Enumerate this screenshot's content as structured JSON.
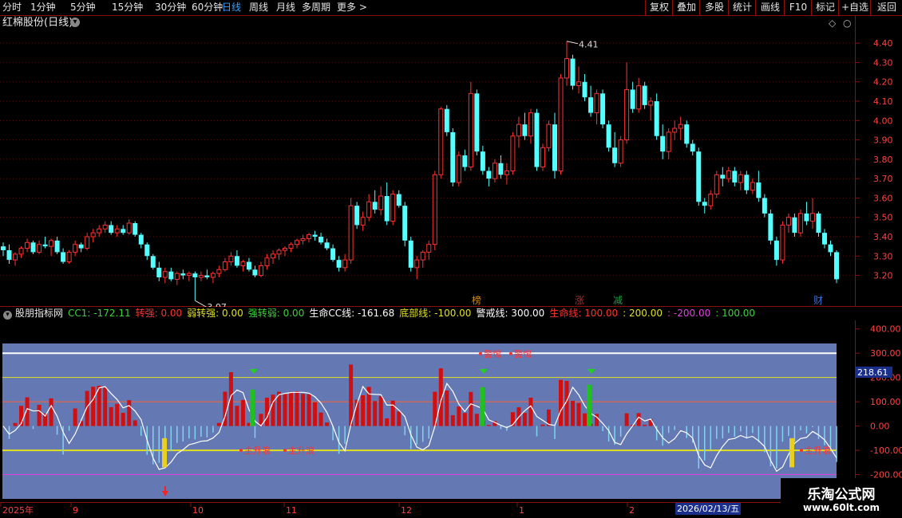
{
  "toolbar": {
    "periods": [
      "分时",
      "1分钟",
      "5分钟",
      "15分钟",
      "30分钟",
      "60分钟",
      "日线",
      "周线",
      "月线",
      "多周期",
      "更多 >"
    ],
    "active": "日线",
    "right_buttons": [
      "复权",
      "叠加",
      "多股",
      "统计",
      "画线",
      "F10",
      "标记",
      "+自选",
      "返回"
    ]
  },
  "stock": {
    "name": "红棉股份(日线)"
  },
  "price_axis": {
    "labels": [
      "4.40",
      "4.30",
      "4.20",
      "4.10",
      "4.00",
      "3.90",
      "3.80",
      "3.70",
      "3.60",
      "3.50",
      "3.40",
      "3.30",
      "3.20"
    ]
  },
  "price_annotations": {
    "high": "4.41",
    "low": "3.07"
  },
  "event_markers": [
    {
      "label": "榜",
      "color": "#d98a00"
    },
    {
      "label": "涨",
      "color": "#c02020"
    },
    {
      "label": "减",
      "color": "#20a040"
    },
    {
      "label": "财",
      "color": "#3a6fd8"
    }
  ],
  "indicator": {
    "name": "股朋指标网",
    "items": [
      {
        "label": "CC1: -172.11",
        "color": "#3fd03f"
      },
      {
        "label": "转强: 0.00",
        "color": "#ff3030"
      },
      {
        "label": "弱转强: 0.00",
        "color": "#e0e020"
      },
      {
        "label": "强转弱: 0.00",
        "color": "#3fd03f"
      },
      {
        "label": "生命CC线: -161.68",
        "color": "#ffffff"
      },
      {
        "label": "底部线: -100.00",
        "color": "#e0e020"
      },
      {
        "label": "警戒线: 300.00",
        "color": "#ffffff"
      },
      {
        "label": "生命线: 100.00",
        "color": "#ff3030"
      },
      {
        "label": ": 200.00",
        "color": "#e0e020"
      },
      {
        "label": ": -200.00",
        "color": "#e040e0"
      },
      {
        "label": ": 100.00",
        "color": "#3fd03f"
      }
    ],
    "axis_labels": [
      "400.00",
      "300.00",
      "200.00",
      "100.00",
      "0.00",
      "-100.00",
      "-200.00"
    ],
    "current_value": "218.61",
    "warning_labels": [
      "警惕",
      "警惕"
    ],
    "rise_labels": [
      "主升浪",
      "主升浪",
      "主升浪"
    ]
  },
  "date_axis": {
    "labels": [
      "2025年",
      "9",
      "10",
      "11",
      "12",
      "1",
      "2"
    ],
    "current_date": "2026/02/13/五"
  },
  "logo": {
    "main": "乐淘公式网",
    "sub": "www.60lt.com"
  },
  "colors": {
    "up": "#ff3232",
    "down": "#54ffff",
    "panel_bg": "#6478b4",
    "border": "#8a1010",
    "axis_text": "#ff4040"
  },
  "chart_data": {
    "type": "candlestick",
    "title": "红棉股份(日线)",
    "y_range": [
      3.12,
      4.45
    ],
    "extremes": {
      "high": 4.41,
      "low": 3.07
    },
    "candles": [
      [
        3.35,
        3.37,
        3.3,
        3.33
      ],
      [
        3.33,
        3.36,
        3.26,
        3.28
      ],
      [
        3.28,
        3.32,
        3.25,
        3.31
      ],
      [
        3.31,
        3.35,
        3.29,
        3.34
      ],
      [
        3.34,
        3.39,
        3.32,
        3.37
      ],
      [
        3.37,
        3.38,
        3.31,
        3.32
      ],
      [
        3.32,
        3.38,
        3.31,
        3.36
      ],
      [
        3.36,
        3.4,
        3.34,
        3.35
      ],
      [
        3.35,
        3.39,
        3.3,
        3.38
      ],
      [
        3.38,
        3.4,
        3.31,
        3.32
      ],
      [
        3.32,
        3.34,
        3.26,
        3.27
      ],
      [
        3.27,
        3.33,
        3.26,
        3.32
      ],
      [
        3.32,
        3.38,
        3.3,
        3.36
      ],
      [
        3.36,
        3.37,
        3.32,
        3.34
      ],
      [
        3.34,
        3.42,
        3.33,
        3.4
      ],
      [
        3.4,
        3.44,
        3.37,
        3.42
      ],
      [
        3.42,
        3.46,
        3.4,
        3.44
      ],
      [
        3.44,
        3.48,
        3.42,
        3.46
      ],
      [
        3.46,
        3.48,
        3.41,
        3.42
      ],
      [
        3.42,
        3.46,
        3.4,
        3.44
      ],
      [
        3.44,
        3.46,
        3.41,
        3.42
      ],
      [
        3.42,
        3.49,
        3.41,
        3.47
      ],
      [
        3.47,
        3.48,
        3.4,
        3.41
      ],
      [
        3.41,
        3.42,
        3.34,
        3.36
      ],
      [
        3.36,
        3.37,
        3.28,
        3.3
      ],
      [
        3.3,
        3.31,
        3.23,
        3.24
      ],
      [
        3.24,
        3.27,
        3.17,
        3.19
      ],
      [
        3.19,
        3.24,
        3.16,
        3.22
      ],
      [
        3.22,
        3.24,
        3.17,
        3.18
      ],
      [
        3.18,
        3.22,
        3.15,
        3.21
      ],
      [
        3.21,
        3.23,
        3.18,
        3.2
      ],
      [
        3.2,
        3.22,
        3.17,
        3.21
      ],
      [
        3.21,
        3.22,
        3.07,
        3.19
      ],
      [
        3.19,
        3.22,
        3.17,
        3.2
      ],
      [
        3.2,
        3.23,
        3.18,
        3.19
      ],
      [
        3.19,
        3.22,
        3.16,
        3.21
      ],
      [
        3.21,
        3.25,
        3.19,
        3.23
      ],
      [
        3.23,
        3.29,
        3.22,
        3.27
      ],
      [
        3.27,
        3.32,
        3.25,
        3.3
      ],
      [
        3.3,
        3.33,
        3.24,
        3.25
      ],
      [
        3.25,
        3.28,
        3.22,
        3.27
      ],
      [
        3.27,
        3.29,
        3.22,
        3.23
      ],
      [
        3.23,
        3.25,
        3.19,
        3.2
      ],
      [
        3.2,
        3.27,
        3.19,
        3.25
      ],
      [
        3.25,
        3.31,
        3.23,
        3.29
      ],
      [
        3.29,
        3.33,
        3.26,
        3.31
      ],
      [
        3.31,
        3.34,
        3.28,
        3.33
      ],
      [
        3.33,
        3.35,
        3.3,
        3.34
      ],
      [
        3.34,
        3.37,
        3.32,
        3.36
      ],
      [
        3.36,
        3.39,
        3.34,
        3.38
      ],
      [
        3.38,
        3.41,
        3.36,
        3.39
      ],
      [
        3.39,
        3.42,
        3.37,
        3.41
      ],
      [
        3.41,
        3.43,
        3.38,
        3.4
      ],
      [
        3.4,
        3.42,
        3.36,
        3.37
      ],
      [
        3.37,
        3.39,
        3.33,
        3.34
      ],
      [
        3.34,
        3.36,
        3.27,
        3.28
      ],
      [
        3.28,
        3.3,
        3.22,
        3.24
      ],
      [
        3.24,
        3.31,
        3.22,
        3.28
      ],
      [
        3.28,
        3.6,
        3.26,
        3.56
      ],
      [
        3.56,
        3.58,
        3.44,
        3.46
      ],
      [
        3.46,
        3.53,
        3.43,
        3.5
      ],
      [
        3.5,
        3.62,
        3.48,
        3.58
      ],
      [
        3.58,
        3.64,
        3.52,
        3.54
      ],
      [
        3.54,
        3.66,
        3.51,
        3.61
      ],
      [
        3.61,
        3.68,
        3.46,
        3.48
      ],
      [
        3.48,
        3.64,
        3.46,
        3.62
      ],
      [
        3.62,
        3.64,
        3.55,
        3.56
      ],
      [
        3.56,
        3.58,
        3.35,
        3.38
      ],
      [
        3.38,
        3.4,
        3.22,
        3.24
      ],
      [
        3.24,
        3.3,
        3.18,
        3.28
      ],
      [
        3.28,
        3.33,
        3.24,
        3.32
      ],
      [
        3.32,
        3.38,
        3.28,
        3.36
      ],
      [
        3.36,
        3.74,
        3.33,
        3.72
      ],
      [
        3.72,
        4.07,
        3.7,
        4.06
      ],
      [
        4.06,
        4.08,
        3.92,
        3.94
      ],
      [
        3.94,
        3.96,
        3.66,
        3.68
      ],
      [
        3.68,
        3.84,
        3.66,
        3.82
      ],
      [
        3.82,
        3.85,
        3.74,
        3.76
      ],
      [
        3.76,
        4.2,
        3.74,
        4.14
      ],
      [
        4.14,
        4.16,
        3.82,
        3.84
      ],
      [
        3.84,
        3.87,
        3.72,
        3.74
      ],
      [
        3.74,
        3.76,
        3.66,
        3.7
      ],
      [
        3.7,
        3.8,
        3.68,
        3.78
      ],
      [
        3.78,
        3.82,
        3.7,
        3.72
      ],
      [
        3.72,
        3.78,
        3.67,
        3.74
      ],
      [
        3.74,
        3.94,
        3.72,
        3.92
      ],
      [
        3.92,
        4.02,
        3.86,
        3.98
      ],
      [
        3.98,
        4.04,
        3.9,
        3.92
      ],
      [
        3.92,
        4.06,
        3.88,
        4.04
      ],
      [
        4.04,
        4.06,
        3.74,
        3.76
      ],
      [
        3.76,
        3.88,
        3.74,
        3.86
      ],
      [
        3.86,
        4.0,
        3.84,
        3.98
      ],
      [
        3.98,
        4.04,
        3.7,
        3.74
      ],
      [
        3.74,
        4.24,
        3.72,
        4.22
      ],
      [
        4.22,
        4.41,
        4.18,
        4.32
      ],
      [
        4.32,
        4.34,
        4.16,
        4.18
      ],
      [
        4.18,
        4.28,
        4.14,
        4.2
      ],
      [
        4.2,
        4.24,
        4.1,
        4.12
      ],
      [
        4.12,
        4.18,
        4.02,
        4.04
      ],
      [
        4.04,
        4.16,
        3.98,
        4.14
      ],
      [
        4.14,
        4.16,
        3.96,
        3.98
      ],
      [
        3.98,
        4.0,
        3.84,
        3.86
      ],
      [
        3.86,
        3.94,
        3.76,
        3.78
      ],
      [
        3.78,
        3.92,
        3.76,
        3.9
      ],
      [
        3.9,
        4.3,
        3.88,
        4.16
      ],
      [
        4.16,
        4.2,
        4.04,
        4.06
      ],
      [
        4.06,
        4.22,
        4.04,
        4.18
      ],
      [
        4.18,
        4.2,
        4.06,
        4.08
      ],
      [
        4.08,
        4.12,
        4.0,
        4.1
      ],
      [
        4.1,
        4.14,
        3.9,
        3.92
      ],
      [
        3.92,
        3.98,
        3.8,
        3.84
      ],
      [
        3.84,
        3.96,
        3.8,
        3.94
      ],
      [
        3.94,
        4.0,
        3.9,
        3.96
      ],
      [
        3.96,
        4.02,
        3.9,
        3.98
      ],
      [
        3.98,
        4.0,
        3.86,
        3.88
      ],
      [
        3.88,
        3.9,
        3.82,
        3.84
      ],
      [
        3.84,
        3.86,
        3.56,
        3.58
      ],
      [
        3.58,
        3.6,
        3.52,
        3.56
      ],
      [
        3.56,
        3.64,
        3.54,
        3.62
      ],
      [
        3.62,
        3.74,
        3.6,
        3.72
      ],
      [
        3.72,
        3.76,
        3.66,
        3.7
      ],
      [
        3.7,
        3.76,
        3.68,
        3.74
      ],
      [
        3.74,
        3.76,
        3.66,
        3.68
      ],
      [
        3.68,
        3.74,
        3.64,
        3.72
      ],
      [
        3.72,
        3.74,
        3.62,
        3.64
      ],
      [
        3.64,
        3.7,
        3.62,
        3.68
      ],
      [
        3.68,
        3.74,
        3.58,
        3.6
      ],
      [
        3.6,
        3.62,
        3.5,
        3.52
      ],
      [
        3.52,
        3.54,
        3.36,
        3.38
      ],
      [
        3.38,
        3.4,
        3.25,
        3.28
      ],
      [
        3.28,
        3.48,
        3.26,
        3.46
      ],
      [
        3.46,
        3.52,
        3.42,
        3.5
      ],
      [
        3.5,
        3.52,
        3.4,
        3.42
      ],
      [
        3.42,
        3.54,
        3.4,
        3.52
      ],
      [
        3.52,
        3.58,
        3.46,
        3.48
      ],
      [
        3.48,
        3.6,
        3.44,
        3.52
      ],
      [
        3.52,
        3.53,
        3.4,
        3.42
      ],
      [
        3.42,
        3.44,
        3.34,
        3.36
      ],
      [
        3.36,
        3.38,
        3.3,
        3.32
      ],
      [
        3.32,
        3.33,
        3.16,
        3.18
      ]
    ]
  }
}
